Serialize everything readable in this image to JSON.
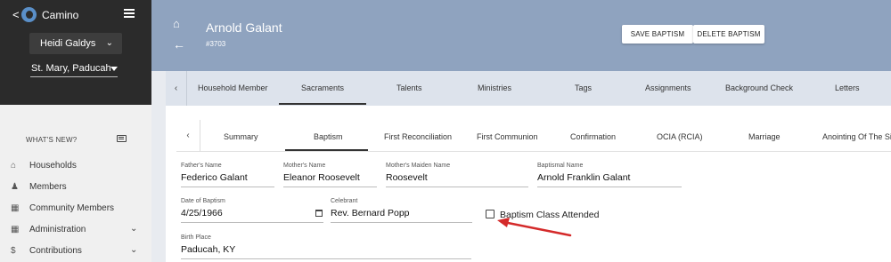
{
  "app": {
    "name": "Camino",
    "back_symbol": "<"
  },
  "sidebar": {
    "user_name": "Heidi Galdys",
    "parish": "St. Mary, Paducah",
    "whats_new": "WHAT'S NEW?",
    "items": [
      {
        "label": "Households",
        "icon": "home-icon"
      },
      {
        "label": "Members",
        "icon": "people-icon"
      },
      {
        "label": "Community Members",
        "icon": "building-icon"
      },
      {
        "label": "Administration",
        "icon": "grid-icon",
        "expandable": true
      },
      {
        "label": "Contributions",
        "icon": "dollar-icon",
        "expandable": true
      }
    ]
  },
  "header": {
    "name": "Arnold Galant",
    "id": "#3703",
    "save_label": "SAVE BAPTISM",
    "delete_label": "DELETE BAPTISM"
  },
  "tabs_primary": [
    "Household Member",
    "Sacraments",
    "Talents",
    "Ministries",
    "Tags",
    "Assignments",
    "Background Check",
    "Letters"
  ],
  "tabs_primary_active": "Sacraments",
  "tabs_secondary": [
    "Summary",
    "Baptism",
    "First Reconciliation",
    "First Communion",
    "Confirmation",
    "OCIA (RCIA)",
    "Marriage",
    "Anointing Of The Si"
  ],
  "tabs_secondary_active": "Baptism",
  "form": {
    "fathers_name": {
      "label": "Father's Name",
      "value": "Federico Galant"
    },
    "mothers_name": {
      "label": "Mother's Name",
      "value": "Eleanor Roosevelt"
    },
    "mothers_maiden_name": {
      "label": "Mother's Maiden Name",
      "value": "Roosevelt"
    },
    "baptismal_name": {
      "label": "Baptismal Name",
      "value": "Arnold Franklin Galant"
    },
    "date_of_baptism": {
      "label": "Date of Baptism",
      "value": "4/25/1966"
    },
    "celebrant": {
      "label": "Celebrant",
      "value": "Rev. Bernard Popp"
    },
    "baptism_class": {
      "label": "Baptism Class Attended",
      "checked": false
    },
    "birth_place": {
      "label": "Birth Place",
      "value": "Paducah, KY"
    }
  },
  "colors": {
    "sidebar_dark": "#2b2b2b",
    "header": "#8fa3bf",
    "tabbar": "#dde3ec",
    "annotation_arrow": "#d42a2a"
  }
}
